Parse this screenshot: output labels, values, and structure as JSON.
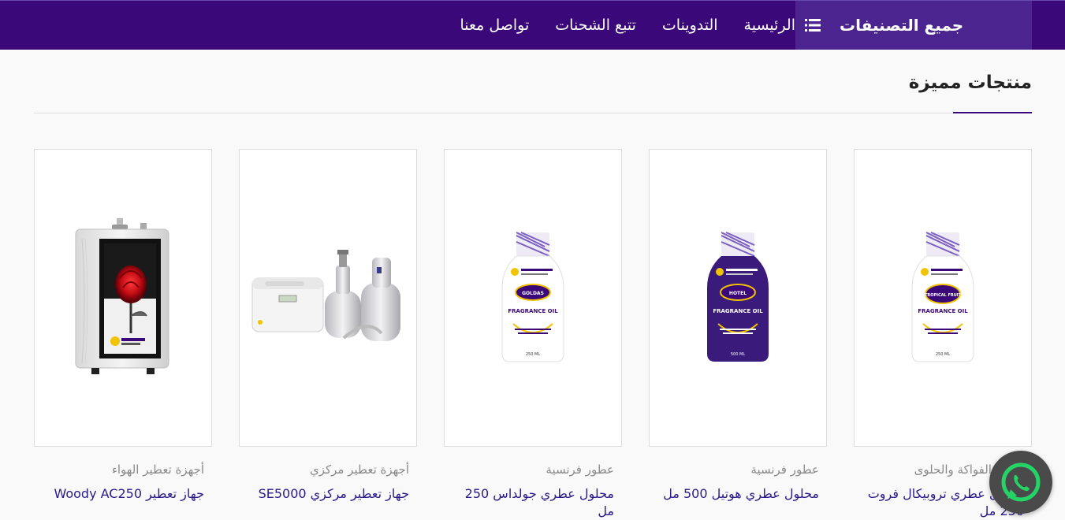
{
  "nav": {
    "all_categories": "جميع التصنيفات",
    "links": [
      "الرئيسية",
      "التدوينات",
      "تتبع الشحنات",
      "تواصل معنا"
    ]
  },
  "section": {
    "title": "منتجات مميزة"
  },
  "products": [
    {
      "category": "أجهزة تعطير الهواء",
      "title": "جهاز تعطير Woody AC250",
      "image": "air-freshener-device"
    },
    {
      "category": "أجهزة تعطير مركزي",
      "title": "جهاز تعطير مركزي SE5000",
      "image": "central-diffuser"
    },
    {
      "category": "عطور فرنسية",
      "title": "محلول عطري جولداس 250 مل",
      "image": "goldas-bottle",
      "bottle_label": "GOLDAS",
      "bottle_oil": "FRAGRANCE OIL",
      "bottle_size": "250 ML"
    },
    {
      "category": "عطور فرنسية",
      "title": "محلول عطري هوتيل 500 مل",
      "image": "hotel-bottle",
      "bottle_label": "HOTEL",
      "bottle_oil": "FRAGRANCE OIL",
      "bottle_size": "500 ML"
    },
    {
      "category": "عطور الفواكة والحلوى",
      "title": "محلول عطري تروبيكال فروت 250 مل",
      "image": "tropical-bottle",
      "bottle_label": "TROPICAL FRUIT",
      "bottle_oil": "FRAGRANCE OIL",
      "bottle_size": "250 ML"
    }
  ],
  "colors": {
    "nav_bg": "#3a0878",
    "nav_cats_bg": "#4b2490",
    "title_link": "#2a1a8a",
    "whatsapp": "#25d366"
  }
}
